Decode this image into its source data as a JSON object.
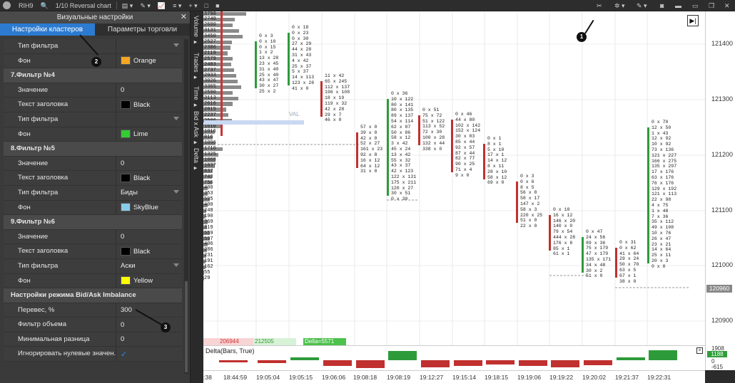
{
  "toolbar": {
    "symbol": "RIH9",
    "chart_name": "1/10 Reversal chart",
    "items_left": [
      "▤ ▾",
      "✎ ▾",
      "📈",
      "≡ ▾",
      "+ ▾",
      "□",
      "■"
    ]
  },
  "panel": {
    "title": "Визуальные настройки",
    "close_glyph": "✕",
    "tabs": [
      "Настройки кластеров",
      "Параметры торговли"
    ],
    "rows": [
      {
        "type": "field",
        "label": "Тип фильтра",
        "value": "",
        "dropdown": true
      },
      {
        "type": "field",
        "label": "Фон",
        "value": "Orange",
        "color": "#f5a623"
      },
      {
        "type": "section",
        "label": "7.Фильтр №4"
      },
      {
        "type": "field",
        "label": "Значение",
        "value": "0"
      },
      {
        "type": "field",
        "label": "Текст заголовка",
        "value": "Black",
        "color": "#000000"
      },
      {
        "type": "field",
        "label": "Тип фильтра",
        "value": "",
        "dropdown": true
      },
      {
        "type": "field",
        "label": "Фон",
        "value": "Lime",
        "color": "#32cd32"
      },
      {
        "type": "section",
        "label": "8.Фильтр №5"
      },
      {
        "type": "field",
        "label": "Значение",
        "value": "0"
      },
      {
        "type": "field",
        "label": "Текст заголовка",
        "value": "Black",
        "color": "#000000"
      },
      {
        "type": "field",
        "label": "Тип фильтра",
        "value": "Биды",
        "dropdown": true
      },
      {
        "type": "field",
        "label": "Фон",
        "value": "SkyBlue",
        "color": "#87ceeb"
      },
      {
        "type": "section",
        "label": "9.Фильтр №6"
      },
      {
        "type": "field",
        "label": "Значение",
        "value": "0"
      },
      {
        "type": "field",
        "label": "Текст заголовка",
        "value": "Black",
        "color": "#000000"
      },
      {
        "type": "field",
        "label": "Тип фильтра",
        "value": "Аски",
        "dropdown": true
      },
      {
        "type": "field",
        "label": "Фон",
        "value": "Yellow",
        "color": "#ffff00"
      },
      {
        "type": "section",
        "label": "Настройки режима Bid/Ask Imbalance"
      },
      {
        "type": "field",
        "label": "Перевес, %",
        "value": "300"
      },
      {
        "type": "field",
        "label": "Фильтр объема",
        "value": "0"
      },
      {
        "type": "field",
        "label": "Минимальная разница",
        "value": "0"
      },
      {
        "type": "check",
        "label": "Игнорировать нулевые значен...",
        "value": "✓"
      }
    ]
  },
  "vertical_tabs": [
    "Volume ▸",
    "Trades ▸",
    "Time ▸",
    "Bid x Ask ▸",
    "Delta ▸"
  ],
  "chart": {
    "y_labels": [
      "121400",
      "121300",
      "121200",
      "121100",
      "121000",
      "120900"
    ],
    "current_price": "120960",
    "x_labels": [
      ":38",
      "18:44:59",
      "19:05:04",
      "19:05:15",
      "19:06:06",
      "19:08:18",
      "19:08:19",
      "19:12:27",
      "19:15:14",
      "19:18:15",
      "19:19:06",
      "19:19:22",
      "19:20:02",
      "19:21:37",
      "19:22:31"
    ],
    "volume_labels": [
      "3790",
      "2748",
      "2600",
      "3131",
      "3450",
      "2527",
      "2386",
      "2119",
      "2579",
      "2483",
      "2737",
      "2933",
      "3026",
      "3365",
      "2590",
      "3113",
      "2616",
      "2015",
      "2237",
      "2506",
      "1610",
      "1016",
      "816",
      "1096",
      "1710",
      "1325",
      "1068",
      "1037",
      "837",
      "743",
      "756",
      "400",
      "353",
      "595",
      "400",
      "248",
      "190",
      "369",
      "319",
      "559",
      "597",
      "406",
      "286",
      "231",
      "191",
      "162",
      "55",
      "29"
    ],
    "val_label": "VAL",
    "bottom_values": [
      "206944",
      "212505",
      "Delta=5571"
    ],
    "delta_title": "Delta(Bars, True)",
    "delta_axis": [
      "1908",
      "1188",
      "0",
      "-615"
    ],
    "chart_button": "▶|"
  },
  "annotations": [
    "1",
    "2",
    "3"
  ],
  "footprint_cols": [
    {
      "rows": [
        "0 x 3",
        "0 x 10",
        "0 x 15",
        "1 x 2",
        "13 x 28",
        "23 x 45",
        "31 x 40",
        "25 x 40",
        "43 x 47",
        "30 x 27",
        "25 x 2"
      ]
    },
    {
      "rows": [
        "0 x 18",
        "0 x 23",
        "0 x 30",
        "27 x 29",
        "44 x 28",
        "31 x 43",
        "4 x 42",
        "25 x 37",
        "5 x 37",
        "14 x 113",
        "123 x 28",
        "41 x 0"
      ]
    },
    {
      "rows": [
        "11 x 42",
        "65 x 245",
        "112 x 137",
        "196 x 108",
        "18 x 19",
        "119 x 32",
        "42 x 28",
        "29 x 7",
        "46 x 0"
      ]
    },
    {
      "rows": [
        "57 x 0",
        "39 x 0",
        "42 x 0",
        "52 x 27",
        "161 x 23",
        "92 x 8",
        "16 x 12",
        "64 x 12",
        "31 x 0"
      ]
    },
    {
      "rows": [
        "0 x 36",
        "10 x 122",
        "80 x 141",
        "80 x 135",
        "89 x 137",
        "54 x 114",
        "62 x 87",
        "50 x 86",
        "58 x 12",
        "3 x 42",
        "45 x 24",
        "13 x 42",
        "55 x 32",
        "43 x 37",
        "42 x 123",
        "122 x 131",
        "175 x 211",
        "120 x 27",
        "30 x 51",
        "0 x 30"
      ]
    },
    {
      "rows": [
        "0 x 51",
        "75 x 72",
        "51 x 122",
        "113 x 52",
        "72 x 30",
        "100 x 28",
        "132 x 44",
        "338 x 0"
      ]
    },
    {
      "rows": [
        "0 x 46",
        "44 x 80",
        "102 x 142",
        "152 x 124",
        "30 x 83",
        "85 x 44",
        "92 x 57",
        "87 x 44",
        "82 x 77",
        "90 x 25",
        "71 x 4",
        "9 x 0"
      ]
    },
    {
      "rows": [
        "0 x 1",
        "8 x 1",
        "5 x 10",
        "17 x 1",
        "14 x 12",
        "8 x 11",
        "28 x 10",
        "58 x 12",
        "69 x 0"
      ]
    },
    {
      "rows": [
        "0 x 3",
        "0 x 6",
        "8 x 5",
        "56 x 8",
        "58 x 17",
        "147 x 2",
        "58 x 3",
        "220 x 25",
        "51 x 0",
        "22 x 0"
      ]
    },
    {
      "rows": [
        "0 x 10",
        "16 x 12",
        "146 x 20",
        "140 x 0",
        "79 x 54",
        "444 x 28",
        "176 x 8",
        "85 x 1",
        "61 x 1"
      ]
    },
    {
      "rows": [
        "0 x 47",
        "24 x 56",
        "89 x 36",
        "75 x 179",
        "47 x 179",
        "135 x 171",
        "34 x 48",
        "30 x 2",
        "51 x 0"
      ]
    },
    {
      "rows": [
        "0 x 31",
        "0 x 62",
        "41 x 64",
        "29 x 24",
        "50 x 70",
        "63 x 5",
        "67 x 1",
        "38 x 0"
      ]
    },
    {
      "rows": [
        "0 x 70",
        "12 x 50",
        "1 x 43",
        "12 x 92",
        "10 x 92",
        "73 x 136",
        "121 x 227",
        "166 x 275",
        "135 x 297",
        "17 x 176",
        "63 x 176",
        "76 x 176",
        "129 x 192",
        "121 x 113",
        "22 x 98",
        "4 x 75",
        "1 x 48",
        "7 x 36",
        "35 x 112",
        "49 x 108",
        "10 x 76",
        "26 x 47",
        "23 x 21",
        "14 x 64",
        "25 x 11",
        "20 x 3",
        "0 x 0"
      ]
    }
  ]
}
